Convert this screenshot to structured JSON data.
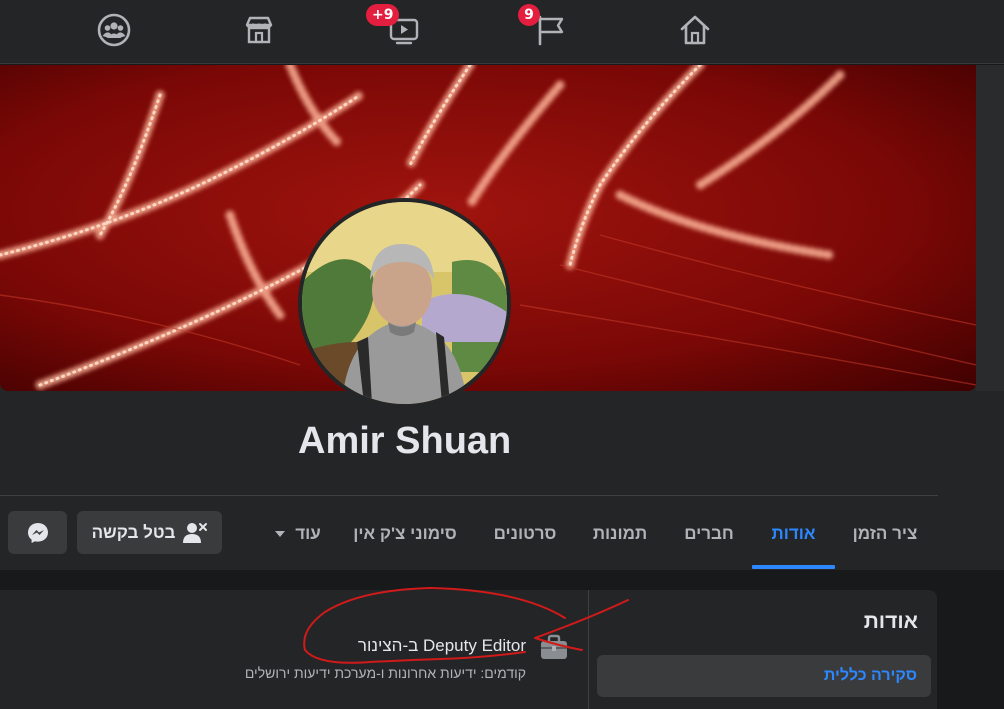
{
  "nav": {
    "badges": {
      "watch": "+9",
      "pages": "9"
    },
    "icons": [
      "groups-icon",
      "marketplace-icon",
      "watch-icon",
      "pages-flag-icon",
      "home-icon"
    ]
  },
  "profile": {
    "name": "Amir Shuan"
  },
  "tabs": {
    "timeline": "ציר הזמן",
    "about": "אודות",
    "friends": "חברים",
    "photos": "תמונות",
    "videos": "סרטונים",
    "checkins": "סימוני צ'ק אין",
    "more": "עוד"
  },
  "actions": {
    "cancel_request": "בטל בקשה"
  },
  "about": {
    "title": "אודות",
    "overview": "סקירה כללית",
    "work": "Deputy Editor ב-הצינור",
    "previous": "קודמים: ידיעות אחרונות ו-מערכת ידיעות ירושלים"
  },
  "colors": {
    "accent": "#2d88ff",
    "badge": "#e41e3f",
    "annotation": "#d11a1a"
  }
}
